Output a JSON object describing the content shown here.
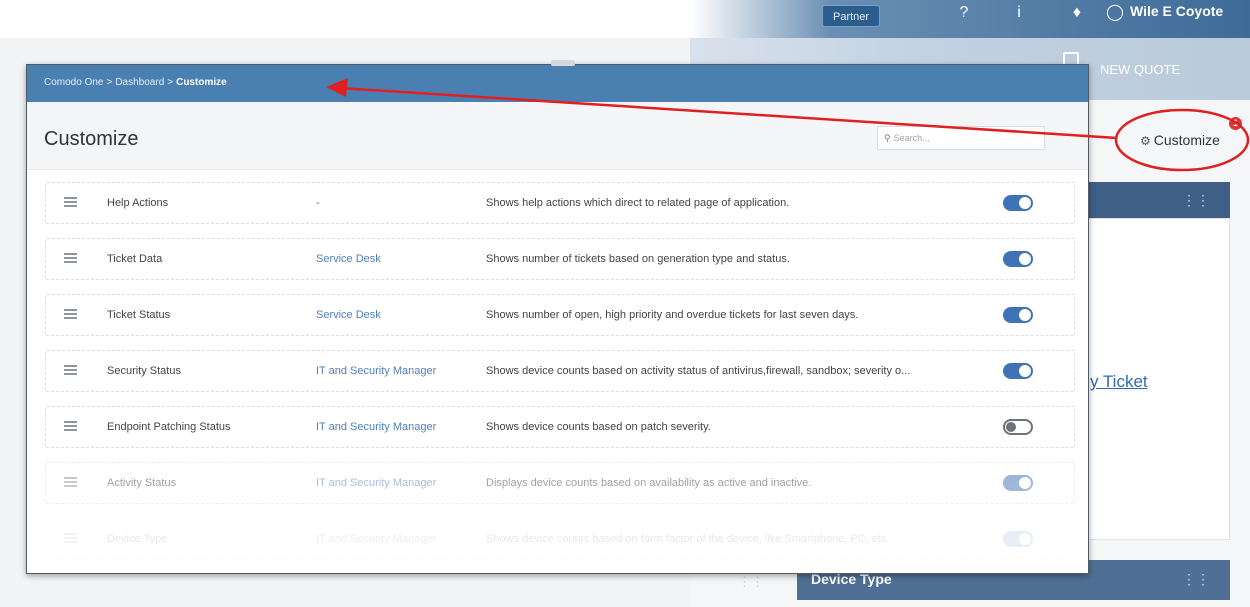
{
  "topbar": {
    "partner_label": "Partner",
    "user_name": "Wile E Coyote",
    "new_quote_label": "NEW QUOTE"
  },
  "background": {
    "customize_link": "Customize",
    "customize_badge": "1",
    "ticket_link": "y Ticket",
    "device_type_label": "Device Type"
  },
  "modal": {
    "breadcrumb": [
      "Comodo One",
      "Dashboard",
      "Customize"
    ],
    "breadcrumb_sep": ">",
    "title": "Customize",
    "search_placeholder": "Search..."
  },
  "rows": [
    {
      "name": "Help Actions",
      "module": "-",
      "description": "Shows help actions which direct to related page of application.",
      "enabled": true
    },
    {
      "name": "Ticket Data",
      "module": "Service Desk",
      "description": "Shows number of tickets based on generation type and status.",
      "enabled": true
    },
    {
      "name": "Ticket Status",
      "module": "Service Desk",
      "description": "Shows number of open, high priority and overdue tickets for last seven days.",
      "enabled": true
    },
    {
      "name": "Security Status",
      "module": "IT and Security Manager",
      "description": "Shows device counts based on activity status of antivirus,firewall, sandbox; severity o...",
      "enabled": true
    },
    {
      "name": "Endpoint Patching Status",
      "module": "IT and Security Manager",
      "description": "Shows device counts based on patch severity.",
      "enabled": false
    },
    {
      "name": "Activity Status",
      "module": "IT and Security Manager",
      "description": "Displays device counts based on availability as active and inactive.",
      "enabled": true
    },
    {
      "name": "Device Type",
      "module": "IT and Security Manager",
      "description": "Shows device counts based on form factor of the device, like Smartphone, PC, etc.",
      "enabled": true
    }
  ],
  "colors": {
    "accent": "#4a7fb2",
    "toggle_on": "#3f73b6",
    "annotation": "#e02020"
  }
}
